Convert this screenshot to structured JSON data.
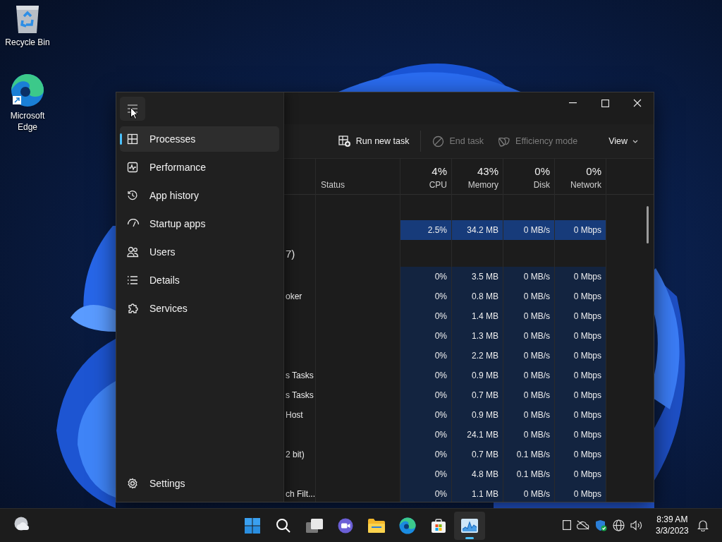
{
  "desktop_icons": [
    {
      "label": "Recycle Bin",
      "kind": "recycle"
    },
    {
      "label": "Microsoft Edge",
      "kind": "edge"
    }
  ],
  "window": {
    "nav": {
      "items": [
        {
          "label": "Processes",
          "kind": "processes",
          "selected": true
        },
        {
          "label": "Performance",
          "kind": "performance",
          "selected": false
        },
        {
          "label": "App history",
          "kind": "history",
          "selected": false
        },
        {
          "label": "Startup apps",
          "kind": "startup",
          "selected": false
        },
        {
          "label": "Users",
          "kind": "users",
          "selected": false
        },
        {
          "label": "Details",
          "kind": "details",
          "selected": false
        },
        {
          "label": "Services",
          "kind": "services",
          "selected": false
        }
      ],
      "settings": "Settings"
    },
    "toolbar": [
      {
        "label": "Run new task",
        "kind": "run",
        "disabled": false
      },
      {
        "label": "End task",
        "kind": "end",
        "disabled": true
      },
      {
        "label": "Efficiency mode",
        "kind": "leaf",
        "disabled": true
      }
    ],
    "view": "View",
    "table": {
      "columns": [
        {
          "label": "Status"
        },
        {
          "percent": "4%",
          "label": "CPU"
        },
        {
          "percent": "43%",
          "label": "Memory"
        },
        {
          "percent": "0%",
          "label": "Disk"
        },
        {
          "percent": "0%",
          "label": "Network"
        }
      ],
      "rows": [
        {
          "kind": "group"
        },
        {
          "kind": "process",
          "highlight": true,
          "values": [
            "2.5%",
            "34.2 MB",
            "0 MB/s",
            "0 Mbps"
          ]
        },
        {
          "kind": "group",
          "name": "7)"
        },
        {
          "kind": "process",
          "highlight": false,
          "values": [
            "0%",
            "3.5 MB",
            "0 MB/s",
            "0 Mbps"
          ]
        },
        {
          "kind": "process",
          "highlight": false,
          "name": "oker",
          "values": [
            "0%",
            "0.8 MB",
            "0 MB/s",
            "0 Mbps"
          ]
        },
        {
          "kind": "process",
          "highlight": false,
          "values": [
            "0%",
            "1.4 MB",
            "0 MB/s",
            "0 Mbps"
          ]
        },
        {
          "kind": "process",
          "highlight": false,
          "values": [
            "0%",
            "1.3 MB",
            "0 MB/s",
            "0 Mbps"
          ]
        },
        {
          "kind": "process",
          "highlight": false,
          "values": [
            "0%",
            "2.2 MB",
            "0 MB/s",
            "0 Mbps"
          ]
        },
        {
          "kind": "process",
          "highlight": false,
          "name": "s Tasks",
          "values": [
            "0%",
            "0.9 MB",
            "0 MB/s",
            "0 Mbps"
          ]
        },
        {
          "kind": "process",
          "highlight": false,
          "name": "s Tasks",
          "values": [
            "0%",
            "0.7 MB",
            "0 MB/s",
            "0 Mbps"
          ]
        },
        {
          "kind": "process",
          "highlight": false,
          "name": "Host",
          "values": [
            "0%",
            "0.9 MB",
            "0 MB/s",
            "0 Mbps"
          ]
        },
        {
          "kind": "process",
          "highlight": false,
          "values": [
            "0%",
            "24.1 MB",
            "0 MB/s",
            "0 Mbps"
          ]
        },
        {
          "kind": "process",
          "highlight": false,
          "name": "2 bit)",
          "values": [
            "0%",
            "0.7 MB",
            "0.1 MB/s",
            "0 Mbps"
          ]
        },
        {
          "kind": "process",
          "highlight": false,
          "values": [
            "0%",
            "4.8 MB",
            "0.1 MB/s",
            "0 Mbps"
          ]
        },
        {
          "kind": "process",
          "highlight": false,
          "name": "ch Filt...",
          "values": [
            "0%",
            "1.1 MB",
            "0 MB/s",
            "0 Mbps"
          ]
        }
      ]
    }
  },
  "taskbar": {
    "weather": {
      "kind": "weather"
    },
    "apps": [
      {
        "kind": "start",
        "active": false
      },
      {
        "kind": "search",
        "active": false
      },
      {
        "kind": "taskview",
        "active": false
      },
      {
        "kind": "chat",
        "active": false
      },
      {
        "kind": "folder",
        "active": false
      },
      {
        "kind": "edge",
        "active": false
      },
      {
        "kind": "store",
        "active": false
      },
      {
        "kind": "taskmgr",
        "active": true
      }
    ],
    "tray": [
      {
        "kind": "rect"
      },
      {
        "kind": "cloud"
      },
      {
        "kind": "shield"
      },
      {
        "kind": "globe"
      },
      {
        "kind": "speaker"
      }
    ],
    "time": "8:39 AM",
    "date": "3/3/2023",
    "notify": {
      "kind": "bell"
    }
  }
}
